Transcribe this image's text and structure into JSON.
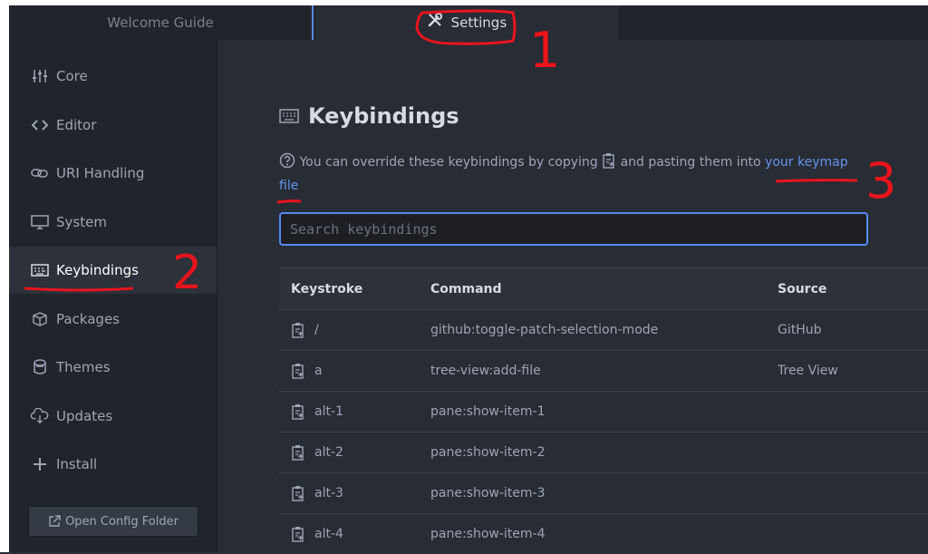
{
  "tabs": {
    "welcome": "Welcome Guide",
    "settings": "Settings"
  },
  "sidebar": {
    "items": [
      {
        "label": "Core",
        "icon": "sliders-icon"
      },
      {
        "label": "Editor",
        "icon": "code-icon"
      },
      {
        "label": "URI Handling",
        "icon": "link-icon"
      },
      {
        "label": "System",
        "icon": "monitor-icon"
      },
      {
        "label": "Keybindings",
        "icon": "keyboard-icon"
      },
      {
        "label": "Packages",
        "icon": "package-icon"
      },
      {
        "label": "Themes",
        "icon": "paintcan-icon"
      },
      {
        "label": "Updates",
        "icon": "cloud-download-icon"
      },
      {
        "label": "Install",
        "icon": "plus-icon"
      }
    ],
    "open_config": "Open Config Folder"
  },
  "main": {
    "title": "Keybindings",
    "info_before": "You can override these keybindings by copying",
    "info_middle": "and pasting them into",
    "info_link": "your keymap file",
    "search_placeholder": "Search keybindings",
    "columns": {
      "keystroke": "Keystroke",
      "command": "Command",
      "source": "Source"
    },
    "rows": [
      {
        "keystroke": "/",
        "command": "github:toggle-patch-selection-mode",
        "source": "GitHub"
      },
      {
        "keystroke": "a",
        "command": "tree-view:add-file",
        "source": "Tree View"
      },
      {
        "keystroke": "alt-1",
        "command": "pane:show-item-1",
        "source": ""
      },
      {
        "keystroke": "alt-2",
        "command": "pane:show-item-2",
        "source": ""
      },
      {
        "keystroke": "alt-3",
        "command": "pane:show-item-3",
        "source": ""
      },
      {
        "keystroke": "alt-4",
        "command": "pane:show-item-4",
        "source": ""
      }
    ]
  },
  "annotations": {
    "one": "1",
    "two": "2",
    "three": "3"
  },
  "colors": {
    "accent": "#568af2",
    "link": "#6494ed",
    "annotation": "#e8141c"
  }
}
